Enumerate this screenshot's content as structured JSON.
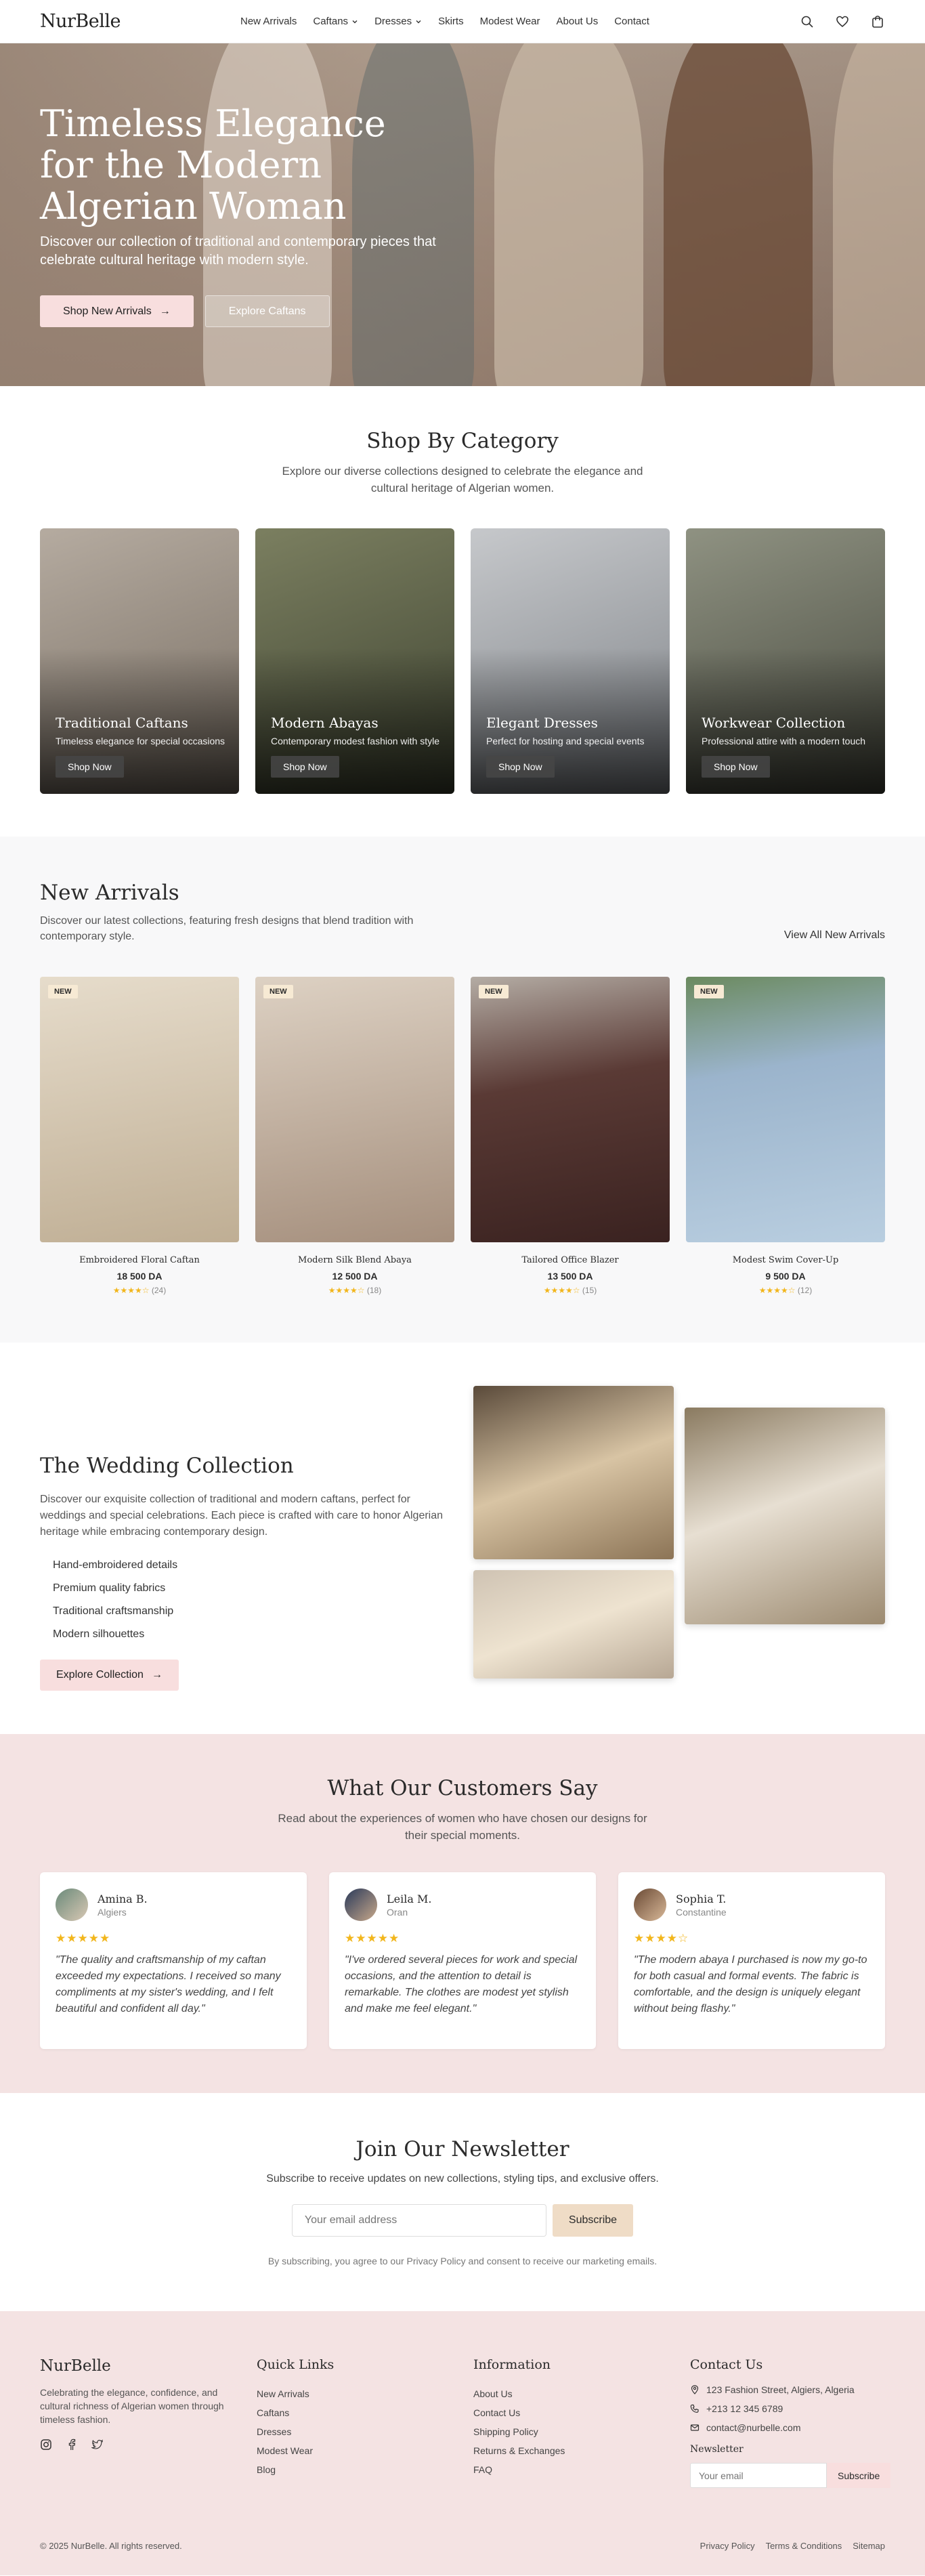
{
  "nav": {
    "logo": "NurBelle",
    "links": [
      "New Arrivals",
      "Caftans",
      "Dresses",
      "Skirts",
      "Modest Wear",
      "About Us",
      "Contact"
    ],
    "icons": [
      "search-icon",
      "heart-icon",
      "cart-icon"
    ]
  },
  "hero": {
    "title": "Timeless Elegance for the Modern Algerian Woman",
    "subtitle": "Discover our collection of traditional and contemporary pieces that celebrate cultural heritage with modern style.",
    "primary_btn": "Shop New Arrivals",
    "secondary_btn": "Explore Caftans"
  },
  "categories": {
    "title": "Shop By Category",
    "subtitle": "Explore our diverse collections designed to celebrate the elegance and cultural heritage of Algerian women.",
    "items": [
      {
        "name": "Traditional Caftans",
        "desc": "Timeless elegance for special occasions",
        "cta": "Shop Now",
        "color": "#8d8377"
      },
      {
        "name": "Modern Abayas",
        "desc": "Contemporary modest fashion with style",
        "cta": "Shop Now",
        "color": "#5c6346"
      },
      {
        "name": "Elegant Dresses",
        "desc": "Perfect for hosting and special events",
        "cta": "Shop Now",
        "color": "#a5a8ab"
      },
      {
        "name": "Workwear Collection",
        "desc": "Professional attire with a modern touch",
        "cta": "Shop Now",
        "color": "#6c6f60"
      }
    ]
  },
  "arrivals": {
    "title": "New Arrivals",
    "subtitle": "Discover our latest collections, featuring fresh designs that blend tradition with contemporary style.",
    "view_all": "View All New Arrivals",
    "products": [
      {
        "badge": "NEW",
        "name": "Embroidered Floral Caftan",
        "price": "18 500 DA",
        "stars": "★★★★☆",
        "reviews": "(24)",
        "color": "#d9cdb8"
      },
      {
        "badge": "NEW",
        "name": "Modern Silk Blend Abaya",
        "price": "12 500 DA",
        "stars": "★★★★☆",
        "reviews": "(18)",
        "color": "#c9b7a6"
      },
      {
        "badge": "NEW",
        "name": "Tailored Office Blazer",
        "price": "13 500 DA",
        "stars": "★★★★☆",
        "reviews": "(15)",
        "color": "#5a3a35"
      },
      {
        "badge": "NEW",
        "name": "Modest Swim Cover-Up",
        "price": "9 500 DA",
        "stars": "★★★★☆",
        "reviews": "(12)",
        "color": "#9bb4cc"
      }
    ]
  },
  "wedding": {
    "title": "The Wedding Collection",
    "desc": "Discover our exquisite collection of traditional and modern caftans, perfect for weddings and special celebrations. Each piece is crafted with care to honor Algerian heritage while embracing contemporary design.",
    "features": [
      "Hand-embroidered details",
      "Premium quality fabrics",
      "Traditional craftsmanship",
      "Modern silhouettes"
    ],
    "cta": "Explore Collection"
  },
  "testimonials": {
    "title": "What Our Customers Say",
    "subtitle": "Read about the experiences of women who have chosen our designs for their special moments.",
    "items": [
      {
        "name": "Amina B.",
        "city": "Algiers",
        "stars": "★★★★★",
        "quote": "\"The quality and craftsmanship of my caftan exceeded my expectations. I received so many compliments at my sister's wedding, and I felt beautiful and confident all day.\""
      },
      {
        "name": "Leila M.",
        "city": "Oran",
        "stars": "★★★★★",
        "quote": "\"I've ordered several pieces for work and special occasions, and the attention to detail is remarkable. The clothes are modest yet stylish and make me feel elegant.\""
      },
      {
        "name": "Sophia T.",
        "city": "Constantine",
        "stars": "★★★★☆",
        "quote": "\"The modern abaya I purchased is now my go-to for both casual and formal events. The fabric is comfortable, and the design is uniquely elegant without being flashy.\""
      }
    ]
  },
  "newsletter": {
    "title": "Join Our Newsletter",
    "subtitle": "Subscribe to receive updates on new collections, styling tips, and exclusive offers.",
    "placeholder": "Your email address",
    "button": "Subscribe",
    "note": "By subscribing, you agree to our Privacy Policy and consent to receive our marketing emails."
  },
  "footer": {
    "brand": "NurBelle",
    "desc": "Celebrating the elegance, confidence, and cultural richness of Algerian women through timeless fashion.",
    "quick_title": "Quick Links",
    "quick": [
      "New Arrivals",
      "Caftans",
      "Dresses",
      "Modest Wear",
      "Blog"
    ],
    "info_title": "Information",
    "info": [
      "About Us",
      "Contact Us",
      "Shipping Policy",
      "Returns & Exchanges",
      "FAQ"
    ],
    "contact_title": "Contact Us",
    "address": "123 Fashion Street, Algiers, Algeria",
    "phone": "+213 12 345 6789",
    "email": "contact@nurbelle.com",
    "newsletter_label": "Newsletter",
    "email_placeholder": "Your email",
    "subscribe": "Subscribe",
    "copyright": "© 2025 NurBelle. All rights reserved.",
    "bottom_links": [
      "Privacy Policy",
      "Terms & Conditions",
      "Sitemap"
    ]
  }
}
